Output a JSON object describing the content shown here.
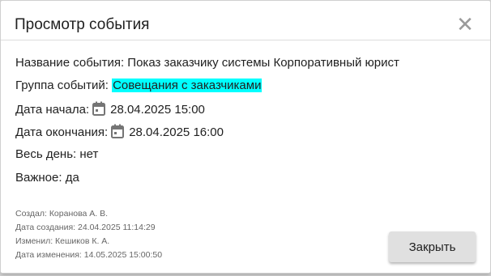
{
  "dialog": {
    "title": "Просмотр события",
    "close_icon": "close-icon"
  },
  "fields": {
    "event_name": {
      "label": "Название события:",
      "value": "Показ заказчику системы Корпоративный юрист"
    },
    "event_group": {
      "label": "Группа событий:",
      "value": "Совещания с заказчиками",
      "highlight_color": "#00ffff"
    },
    "start_date": {
      "label": "Дата начала:",
      "icon": "calendar-icon",
      "value": "28.04.2025 15:00"
    },
    "end_date": {
      "label": "Дата окончания:",
      "icon": "calendar-icon",
      "value": "28.04.2025 16:00"
    },
    "all_day": {
      "label": "Весь день:",
      "value": "нет"
    },
    "important": {
      "label": "Важное:",
      "value": "да"
    }
  },
  "audit": {
    "created_by": "Создал: Коранова А. В.",
    "created_at": "Дата создания: 24.04.2025 11:14:29",
    "modified_by": "Изменил: Кешиков К. А.",
    "modified_at": "Дата изменения: 14.05.2025 15:00:50"
  },
  "footer": {
    "close_button_label": "Закрыть"
  },
  "colors": {
    "accent_highlight": "#00ffff",
    "icon_gray": "#757575"
  }
}
